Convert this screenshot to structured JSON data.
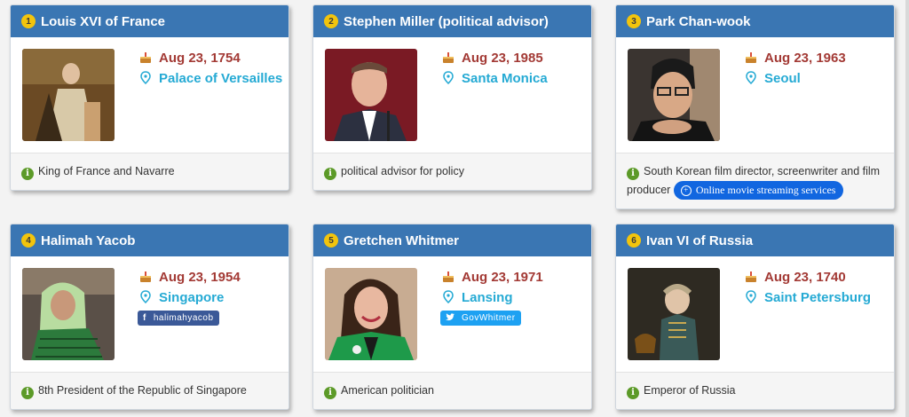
{
  "cards": [
    {
      "rank": "1",
      "name": "Louis XVI of France",
      "date": "Aug 23, 1754",
      "place": "Palace of Versailles",
      "desc": "King of France and Navarre",
      "photo": "portrait-photo"
    },
    {
      "rank": "2",
      "name": "Stephen Miller (political advisor)",
      "date": "Aug 23, 1985",
      "place": "Santa Monica",
      "desc": "political advisor for policy",
      "photo": "portrait-photo"
    },
    {
      "rank": "3",
      "name": "Park Chan-wook",
      "date": "Aug 23, 1963",
      "place": "Seoul",
      "desc": "South Korean film director, screenwriter and film producer",
      "ad": "Online movie streaming services",
      "photo": "portrait-photo"
    },
    {
      "rank": "4",
      "name": "Halimah Yacob",
      "date": "Aug 23, 1954",
      "place": "Singapore",
      "desc": "8th President of the Republic of Singapore",
      "social": {
        "network": "facebook",
        "icon": "f",
        "handle": "halimahyacob"
      },
      "photo": "portrait-photo"
    },
    {
      "rank": "5",
      "name": "Gretchen Whitmer",
      "date": "Aug 23, 1971",
      "place": "Lansing",
      "desc": "American politician",
      "social": {
        "network": "twitter",
        "icon": "t",
        "handle": "GovWhitmer"
      },
      "photo": "portrait-photo"
    },
    {
      "rank": "6",
      "name": "Ivan VI of Russia",
      "date": "Aug 23, 1740",
      "place": "Saint Petersburg",
      "desc": "Emperor of Russia",
      "photo": "portrait-photo"
    }
  ],
  "colors": {
    "header": "#3a76b3",
    "date": "#a33a35",
    "place": "#25aad4",
    "rank_badge": "#f2c40d",
    "info_icon": "#5c9a28",
    "ad_button": "#1166e0"
  },
  "icons": {
    "birthday": "cake-icon",
    "location": "map-pin-icon",
    "info": "info-icon"
  }
}
